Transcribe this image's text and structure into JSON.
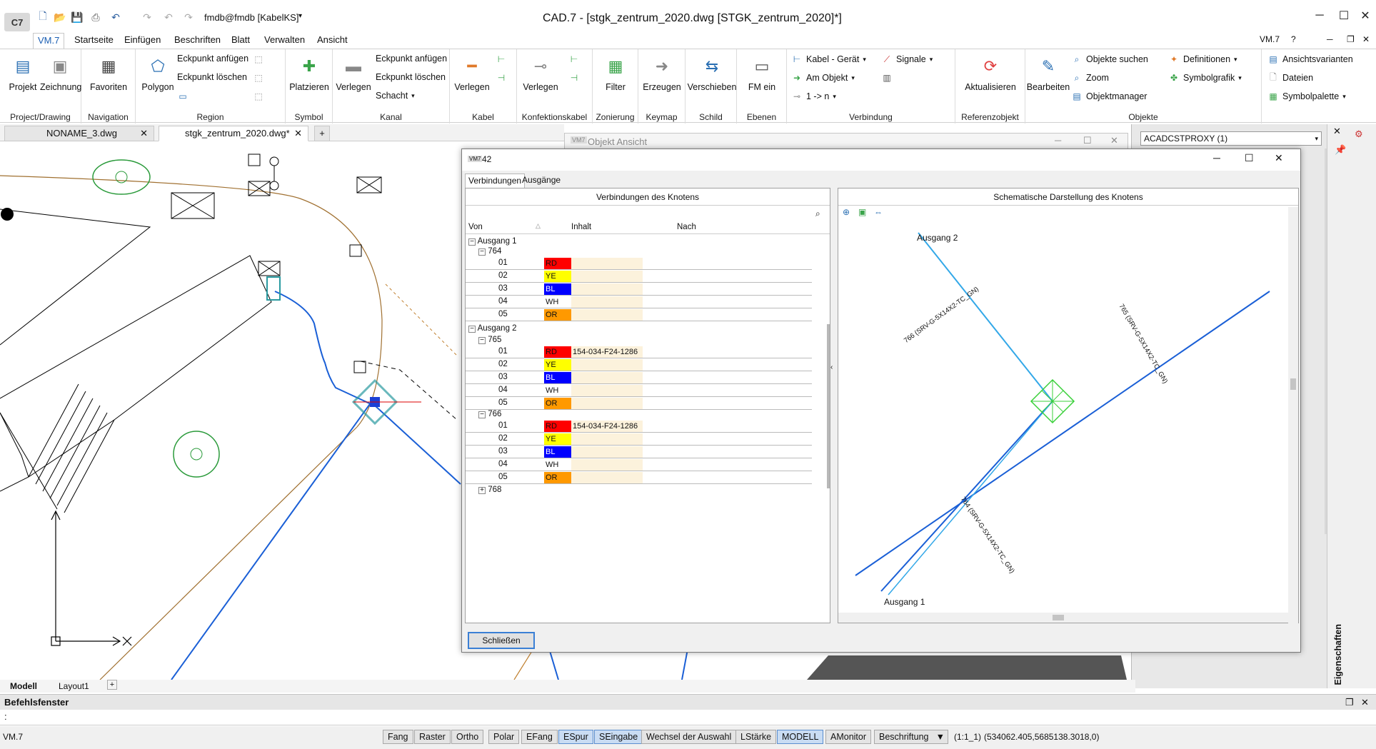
{
  "app": {
    "logo": "C7",
    "user": "fmdb@fmdb [KabelKS]",
    "window_title": "CAD.7 - [stgk_zentrum_2020.dwg [STGK_zentrum_2020]*]",
    "right_label": "VM.7"
  },
  "ribbon_tabs": [
    "VM.7",
    "Startseite",
    "Einfügen",
    "Beschriften",
    "Blatt",
    "Verwalten",
    "Ansicht"
  ],
  "ribbon": {
    "groups": {
      "project": "Project/Drawing",
      "navigation": "Navigation",
      "region": "Region",
      "symbol": "Symbol",
      "kanal": "Kanal",
      "kabel": "Kabel",
      "konf": "Konfektionskabel",
      "zon": "Zonierung",
      "keymap": "Keymap",
      "schild": "Schild",
      "ebenen": "Ebenen",
      "verbindung": "Verbindung",
      "referenz": "Referenzobjekt",
      "objekte": "Objekte"
    },
    "buttons": {
      "projekt": "Projekt",
      "zeichnung": "Zeichnung",
      "favoriten": "Favoriten",
      "polygon": "Polygon",
      "eck_anf": "Eckpunkt anfügen",
      "eck_loe": "Eckpunkt löschen",
      "platzieren": "Platzieren",
      "verlegen1": "Verlegen",
      "eck_anf2": "Eckpunkt anfügen",
      "eck_loe2": "Eckpunkt löschen",
      "schacht": "Schacht",
      "verlegen2": "Verlegen",
      "verlegen3": "Verlegen",
      "filter": "Filter",
      "erzeugen": "Erzeugen",
      "verschieben": "Verschieben",
      "fm_ein": "FM ein",
      "kabel_geraet": "Kabel - Gerät",
      "am_objekt": "Am Objekt",
      "one_n": "1 -> n",
      "signale": "Signale",
      "aktualisieren": "Aktualisieren",
      "bearbeiten": "Bearbeiten",
      "obj_suchen": "Objekte suchen",
      "zoom": "Zoom",
      "objektmanager": "Objektmanager",
      "definitionen": "Definitionen",
      "symbolgrafik": "Symbolgrafik",
      "ansichtsvarianten": "Ansichtsvarianten",
      "dateien": "Dateien",
      "symbolpalette": "Symbolpalette"
    }
  },
  "doc_tabs": [
    "NONAME_3.dwg",
    "stgk_zentrum_2020.dwg*"
  ],
  "properties": {
    "dropdown": "ACADCSTPROXY (1)",
    "side_label": "Eigenschaften"
  },
  "objekt_ansicht": {
    "title": "Objekt Ansicht"
  },
  "dialog": {
    "title": "42",
    "tabs": [
      "Verbindungen",
      "Ausgänge"
    ],
    "left_header": "Verbindungen des Knotens",
    "right_header": "Schematische Darstellung des Knotens",
    "columns": [
      "Von",
      "Inhalt",
      "Nach"
    ],
    "tree": {
      "ausgang1": "Ausgang 1",
      "c764": "764",
      "ausgang2": "Ausgang 2",
      "c765": "765",
      "c766": "766",
      "c768": "768"
    },
    "rows": [
      {
        "num": "01",
        "code": "RD",
        "content": "",
        "color": "#ff0000"
      },
      {
        "num": "02",
        "code": "YE",
        "content": "",
        "color": "#ffff00"
      },
      {
        "num": "03",
        "code": "BL",
        "content": "",
        "color": "#0000ff"
      },
      {
        "num": "04",
        "code": "WH",
        "content": "",
        "color": "#ffffff"
      },
      {
        "num": "05",
        "code": "OR",
        "content": "",
        "color": "#ff9900"
      },
      {
        "num": "01",
        "code": "RD",
        "content": "154-034-F24-1286",
        "color": "#ff0000"
      },
      {
        "num": "02",
        "code": "YE",
        "content": "",
        "color": "#ffff00"
      },
      {
        "num": "03",
        "code": "BL",
        "content": "",
        "color": "#0000ff"
      },
      {
        "num": "04",
        "code": "WH",
        "content": "",
        "color": "#ffffff"
      },
      {
        "num": "05",
        "code": "OR",
        "content": "",
        "color": "#ff9900"
      },
      {
        "num": "01",
        "code": "RD",
        "content": "154-034-F24-1286",
        "color": "#ff0000"
      },
      {
        "num": "02",
        "code": "YE",
        "content": "",
        "color": "#ffff00"
      },
      {
        "num": "03",
        "code": "BL",
        "content": "",
        "color": "#0000ff"
      },
      {
        "num": "04",
        "code": "WH",
        "content": "",
        "color": "#ffffff"
      },
      {
        "num": "05",
        "code": "OR",
        "content": "",
        "color": "#ff9900"
      }
    ],
    "schema": {
      "ausgang2": "Ausgang 2",
      "ausgang1": "Ausgang 1",
      "lbl_a": "766 (SRV-G-5X14X2-TC_GN)",
      "lbl_b": "765 (SRV-G-5X14X2-TC_GN)",
      "lbl_c": "764 (SRV-G-5X14X2-TC_GN)"
    },
    "close": "Schließen"
  },
  "layout_tabs": [
    "Modell",
    "Layout1"
  ],
  "command": {
    "header": "Befehlsfenster",
    "prompt": ":"
  },
  "status": {
    "left": "VM.7",
    "buttons": [
      "Fang",
      "Raster",
      "Ortho",
      "Polar",
      "EFang",
      "ESpur",
      "SEingabe",
      "Wechsel der Auswahl",
      "LStärke",
      "MODELL",
      "AMonitor",
      "Beschriftung"
    ],
    "scale": "(1:1_1)",
    "coords": "(534062.405,5685138.3018,0)"
  }
}
